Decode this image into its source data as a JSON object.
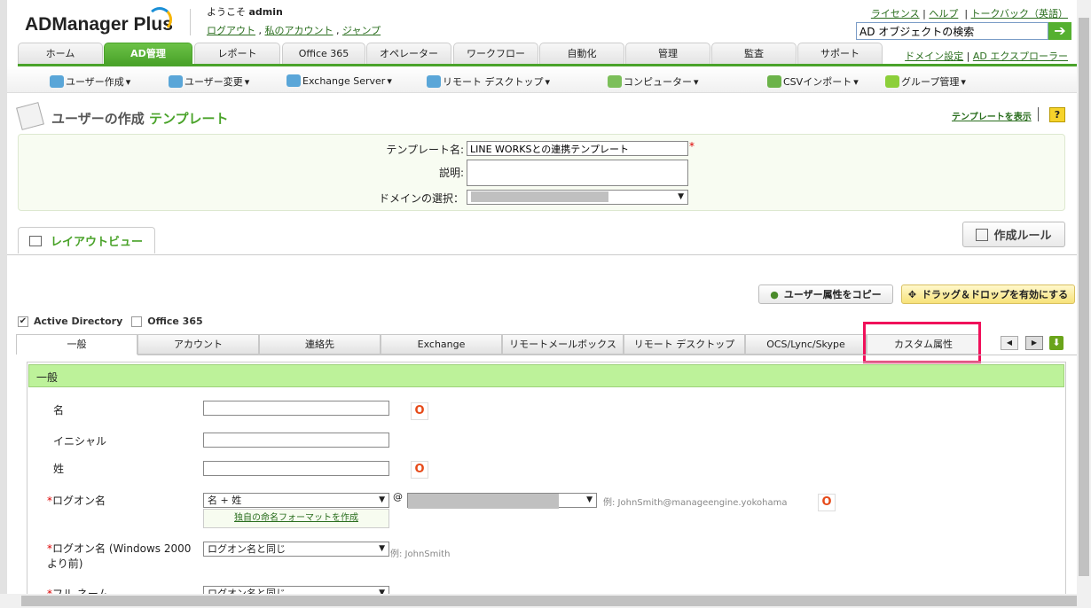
{
  "header": {
    "logo": "ADManager Plus",
    "welcome": "ようこそ",
    "user": "admin",
    "links": [
      "ログアウト",
      "私のアカウント",
      "ジャンプ"
    ],
    "top_links": [
      "ライセンス",
      "ヘルプ",
      "トークバック（英語）"
    ],
    "search_placeholder": "AD オブジェクトの検索",
    "domain_links": [
      "ドメイン設定",
      "AD エクスプローラー"
    ]
  },
  "tabs": [
    "ホーム",
    "AD管理",
    "レポート",
    "Office 365",
    "オペレーター",
    "ワークフロー",
    "自動化",
    "管理",
    "監査",
    "サポート"
  ],
  "submenu": [
    "ユーザー作成",
    "ユーザー変更",
    "Exchange Server",
    "リモート デスクトップ",
    "コンピューター",
    "CSVインポート",
    "グループ管理"
  ],
  "page": {
    "title": "ユーザーの作成",
    "title_accent": "テンプレート",
    "show_template": "テンプレートを表示",
    "help": "?"
  },
  "form": {
    "name_label": "テンプレート名:",
    "name_value": "LINE WORKSとの連携テンプレート",
    "desc_label": "説明:",
    "domain_label": "ドメインの選択："
  },
  "layout_tab": "レイアウトビュー",
  "rules_button": "作成ルール",
  "copy_button": "ユーザー属性をコピー",
  "dragdrop_button": "ドラッグ＆ドロップを有効にする",
  "checks": [
    {
      "label": "Active Directory",
      "checked": true
    },
    {
      "label": "Office 365",
      "checked": false
    }
  ],
  "content_tabs": [
    "一般",
    "アカウント",
    "連絡先",
    "Exchange",
    "リモートメールボックス",
    "リモート デスクトップ",
    "OCS/Lync/Skype",
    "カスタム属性"
  ],
  "section": {
    "title": "一般",
    "first_name": "名",
    "initials": "イニシャル",
    "last_name": "姓",
    "logon_label": "ログオン名",
    "logon_value": "名 + 姓",
    "at": "@",
    "logon_example": "例:  JohnSmith@manageengine.yokohama",
    "custom_format": "独自の命名フォーマットを作成",
    "pre2000_label": "ログオン名 (Windows 2000 より前)",
    "pre2000_value": "ログオン名と同じ",
    "pre2000_example": "例:   JohnSmith",
    "fullname_label": "フル ネーム",
    "fullname_value": "ログオン名と同じ",
    "o365": "O"
  }
}
